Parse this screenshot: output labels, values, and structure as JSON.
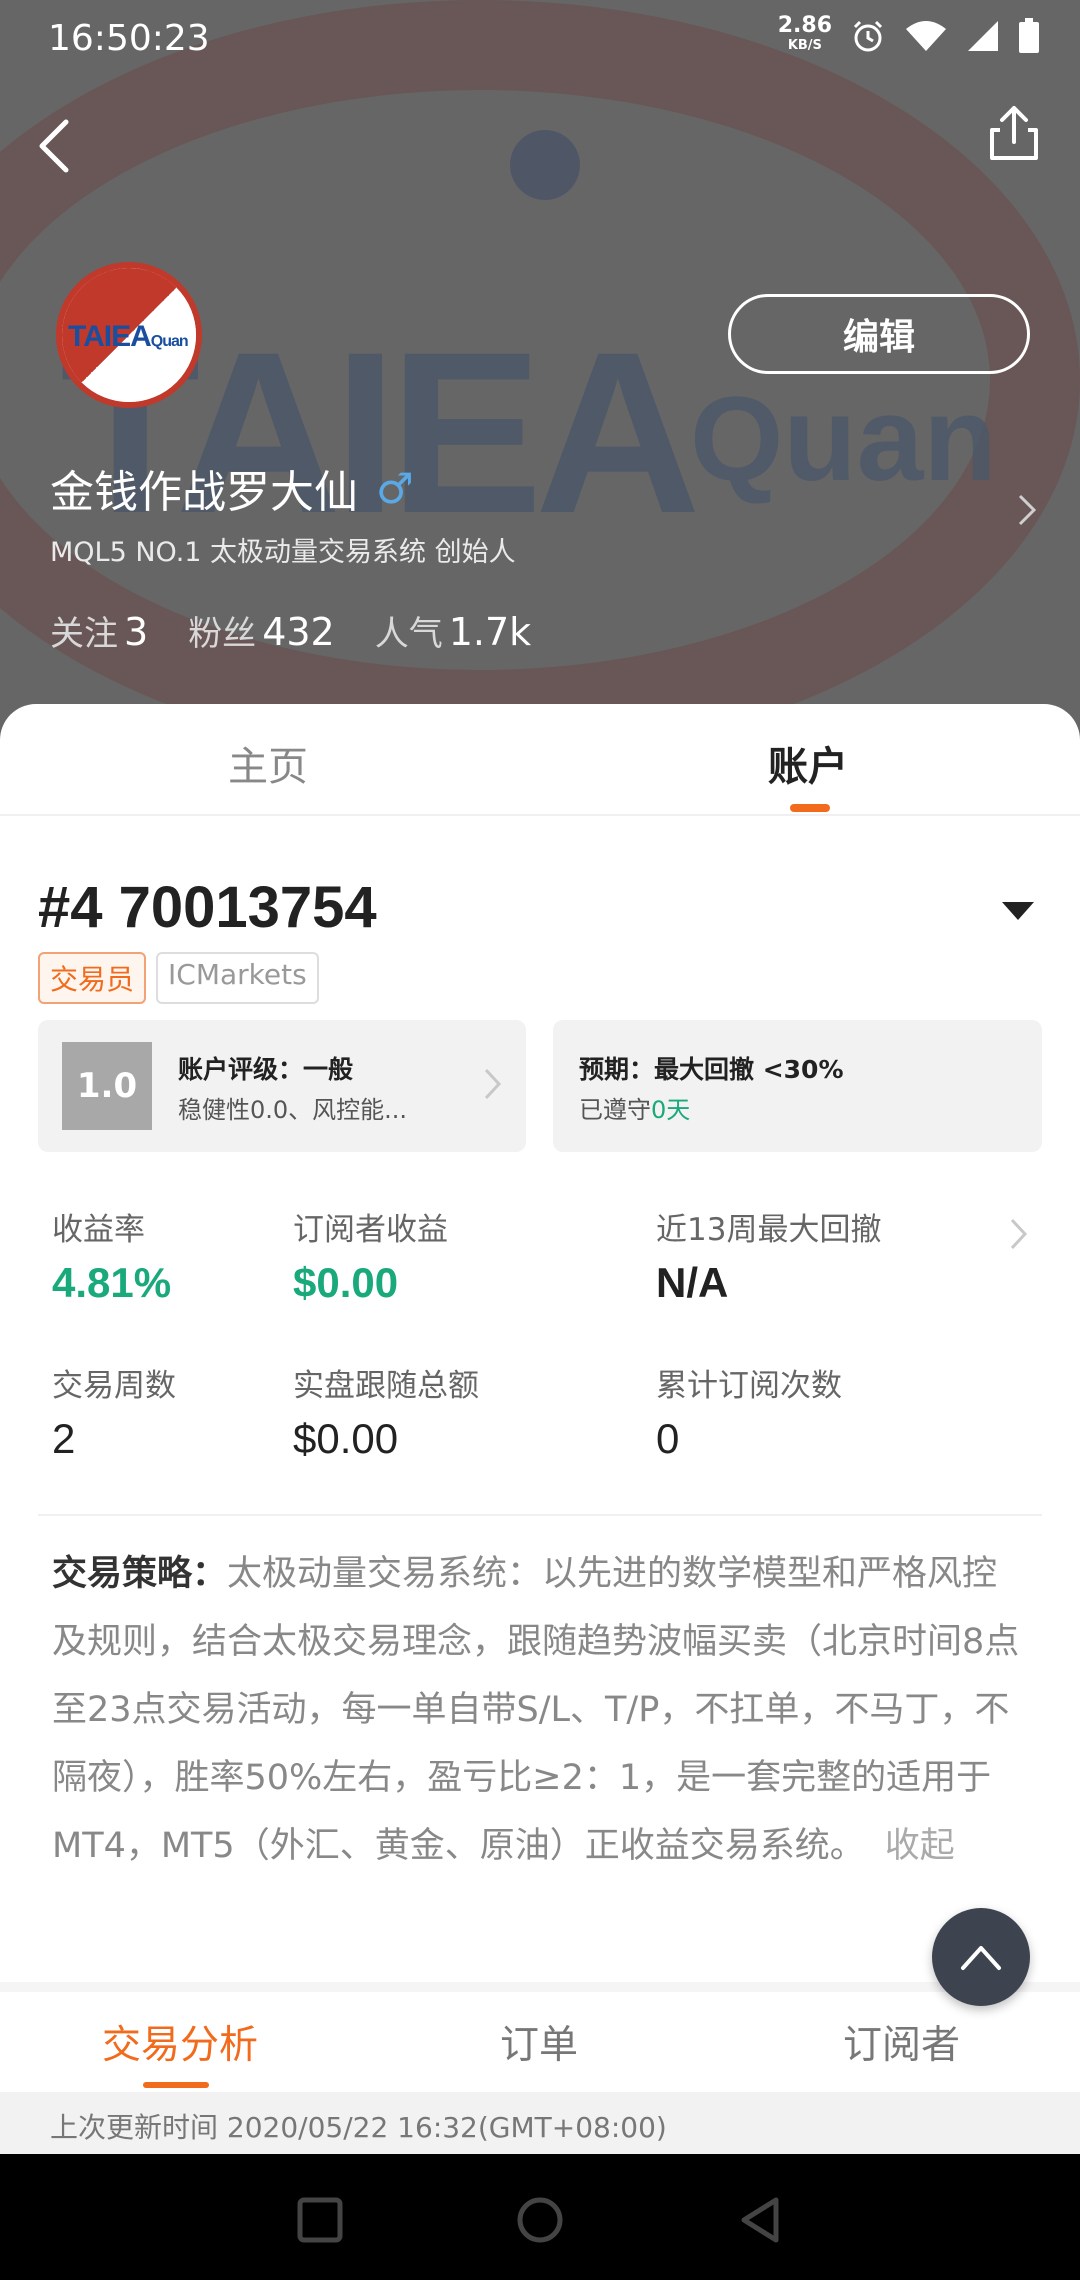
{
  "status_bar": {
    "time": "16:50:23",
    "net_speed_value": "2.86",
    "net_speed_unit": "KB/S",
    "icons": [
      "alarm-icon",
      "wifi-icon",
      "signal-icon",
      "battery-icon"
    ]
  },
  "header": {
    "avatar_text": "TAIEA",
    "avatar_text_small": "Quan",
    "edit_label": "编辑",
    "name": "金钱作战罗大仙",
    "gender_symbol": "♂",
    "subtitle": "MQL5 NO.1 太极动量交易系统 创始人",
    "stats": [
      {
        "label": "关注",
        "value": "3"
      },
      {
        "label": "粉丝",
        "value": "432"
      },
      {
        "label": "人气",
        "value": "1.7k"
      }
    ]
  },
  "tabs_top": [
    {
      "label": "主页",
      "active": false
    },
    {
      "label": "账户",
      "active": true
    }
  ],
  "account": {
    "number": "#4 70013754",
    "tags": [
      "交易员",
      "ICMarkets"
    ],
    "rating": {
      "score": "1.0",
      "title": "账户评级：一般",
      "sub": "稳健性0.0、风控能..."
    },
    "expectation": {
      "title": "预期：最大回撤 <30%",
      "sub_prefix": "已遵守",
      "sub_value": "0天"
    }
  },
  "metrics": [
    {
      "label": "收益率",
      "value": "4.81%"
    },
    {
      "label": "订阅者收益",
      "value": "$0.00"
    },
    {
      "label": "近13周最大回撤",
      "value": "N/A"
    },
    {
      "label": "交易周数",
      "value": "2"
    },
    {
      "label": "实盘跟随总额",
      "value": "$0.00"
    },
    {
      "label": "累计订阅次数",
      "value": "0"
    }
  ],
  "strategy": {
    "label": "交易策略：",
    "text": "太极动量交易系统：以先进的数学模型和严格风控及规则，结合太极交易理念，跟随趋势波幅买卖（北京时间8点至23点交易活动，每一单自带S/L、T/P，不扛单，不马丁，不隔夜），胜率50%左右，盈亏比≥2：1，是一套完整的适用于MT4，MT5（外汇、黄金、原油）正收益交易系统。",
    "collapse_label": "收起"
  },
  "tabs_bottom": [
    {
      "label": "交易分析",
      "active": true
    },
    {
      "label": "订单",
      "active": false
    },
    {
      "label": "订阅者",
      "active": false
    }
  ],
  "update_text": "上次更新时间 2020/05/22 16:32(GMT+08:00)",
  "colors": {
    "accent": "#f26a1b",
    "green": "#19a97b",
    "gender": "#5aa9e6"
  }
}
